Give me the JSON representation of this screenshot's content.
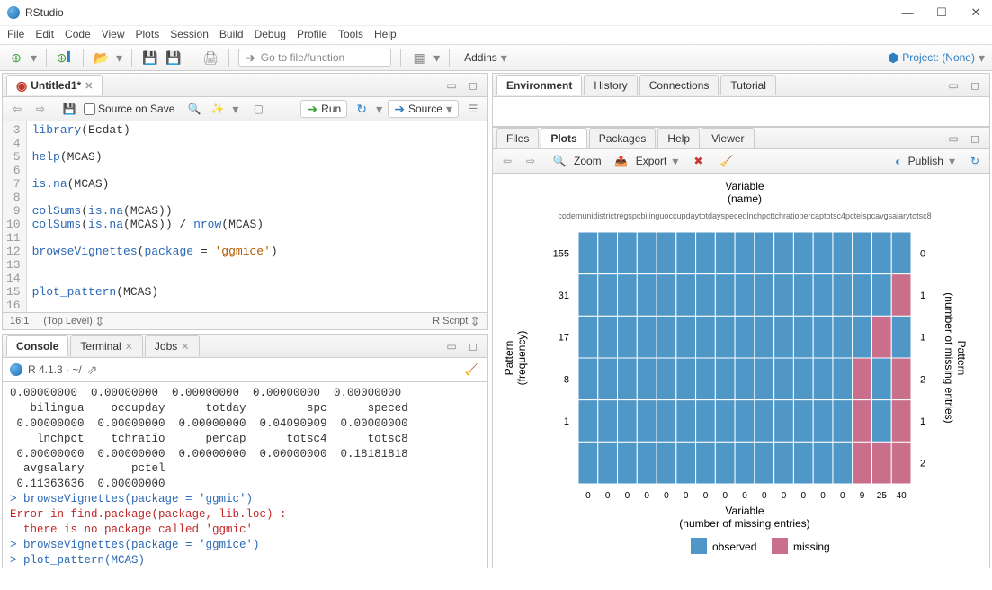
{
  "window": {
    "title": "RStudio"
  },
  "menubar": [
    "File",
    "Edit",
    "Code",
    "View",
    "Plots",
    "Session",
    "Build",
    "Debug",
    "Profile",
    "Tools",
    "Help"
  ],
  "toolbar": {
    "gotofile_placeholder": "Go to file/function",
    "addins_label": "Addins",
    "project_label": "Project: (None)"
  },
  "source": {
    "tab_name": "Untitled1*",
    "source_on_save": "Source on Save",
    "run_label": "Run",
    "source_label": "Source",
    "status_left": "16:1",
    "status_mid": "(Top Level)",
    "status_right": "R Script",
    "lines": [
      {
        "n": 3,
        "text": "library(Ecdat)"
      },
      {
        "n": 4,
        "text": ""
      },
      {
        "n": 5,
        "text": "help(MCAS)"
      },
      {
        "n": 6,
        "text": ""
      },
      {
        "n": 7,
        "text": "is.na(MCAS)"
      },
      {
        "n": 8,
        "text": ""
      },
      {
        "n": 9,
        "text": "colSums(is.na(MCAS))"
      },
      {
        "n": 10,
        "text": "colSums(is.na(MCAS)) / nrow(MCAS)"
      },
      {
        "n": 11,
        "text": ""
      },
      {
        "n": 12,
        "text": "browseVignettes(package = 'ggmice')"
      },
      {
        "n": 13,
        "text": ""
      },
      {
        "n": 14,
        "text": ""
      },
      {
        "n": 15,
        "text": "plot_pattern(MCAS)"
      },
      {
        "n": 16,
        "text": ""
      }
    ]
  },
  "env_tabs": [
    "Environment",
    "History",
    "Connections",
    "Tutorial"
  ],
  "plot_tabs": [
    "Files",
    "Plots",
    "Packages",
    "Help",
    "Viewer"
  ],
  "plot_tools": {
    "zoom": "Zoom",
    "export": "Export",
    "publish": "Publish"
  },
  "console": {
    "tab_console": "Console",
    "tab_terminal": "Terminal",
    "tab_jobs": "Jobs",
    "r_version": "R 4.1.3 · ~/",
    "out1": "0.00000000  0.00000000  0.00000000  0.00000000  0.00000000",
    "out2": "   bilingua    occupday      totday         spc      speced",
    "out3": " 0.00000000  0.00000000  0.00000000  0.04090909  0.00000000",
    "out4": "    lnchpct    tchratio      percap      totsc4      totsc8",
    "out5": " 0.00000000  0.00000000  0.00000000  0.00000000  0.18181818",
    "out6": "  avgsalary       pctel",
    "out7": " 0.11363636  0.00000000",
    "cmd1": "> browseVignettes(package = 'ggmic')",
    "err1": "Error in find.package(package, lib.loc) : ",
    "err2": "  there is no package called 'ggmic'",
    "cmd2": "> browseVignettes(package = 'ggmice')",
    "cmd3": "> plot_pattern(MCAS)",
    "prompt": "> "
  },
  "chart_data": {
    "type": "heatmap",
    "title_top": "Variable\n(name)",
    "xlabel_bottom": "Variable\n(number of missing entries)",
    "ylabel_left": "Pattern\n(frequency)",
    "ylabel_right": "Pattern\n(number of missing entries)",
    "x_top_label": "codemunidistrictregspcbilinguoccupdaytotdayspecedlnchpcttchratiopercaptotsc4pctelspсavgsalarytotsc8",
    "y_left_ticks": [
      "155",
      "31",
      "17",
      "8",
      "1"
    ],
    "x_bottom_ticks": [
      "0",
      "0",
      "0",
      "0",
      "0",
      "0",
      "0",
      "0",
      "0",
      "0",
      "0",
      "0",
      "0",
      "0",
      "9",
      "25",
      "40"
    ],
    "y_right_ticks": [
      "0",
      "1",
      "1",
      "2",
      "1",
      "2"
    ],
    "legend": {
      "observed": "observed",
      "missing": "missing"
    },
    "n_cols": 17,
    "n_rows": 6,
    "missing_cells": [
      [
        1,
        16
      ],
      [
        2,
        15
      ],
      [
        3,
        14
      ],
      [
        3,
        16
      ],
      [
        4,
        14
      ],
      [
        4,
        16
      ],
      [
        5,
        14
      ],
      [
        5,
        15
      ],
      [
        5,
        16
      ]
    ],
    "colors": {
      "observed": "#4f97c7",
      "missing": "#c96f8b"
    }
  }
}
